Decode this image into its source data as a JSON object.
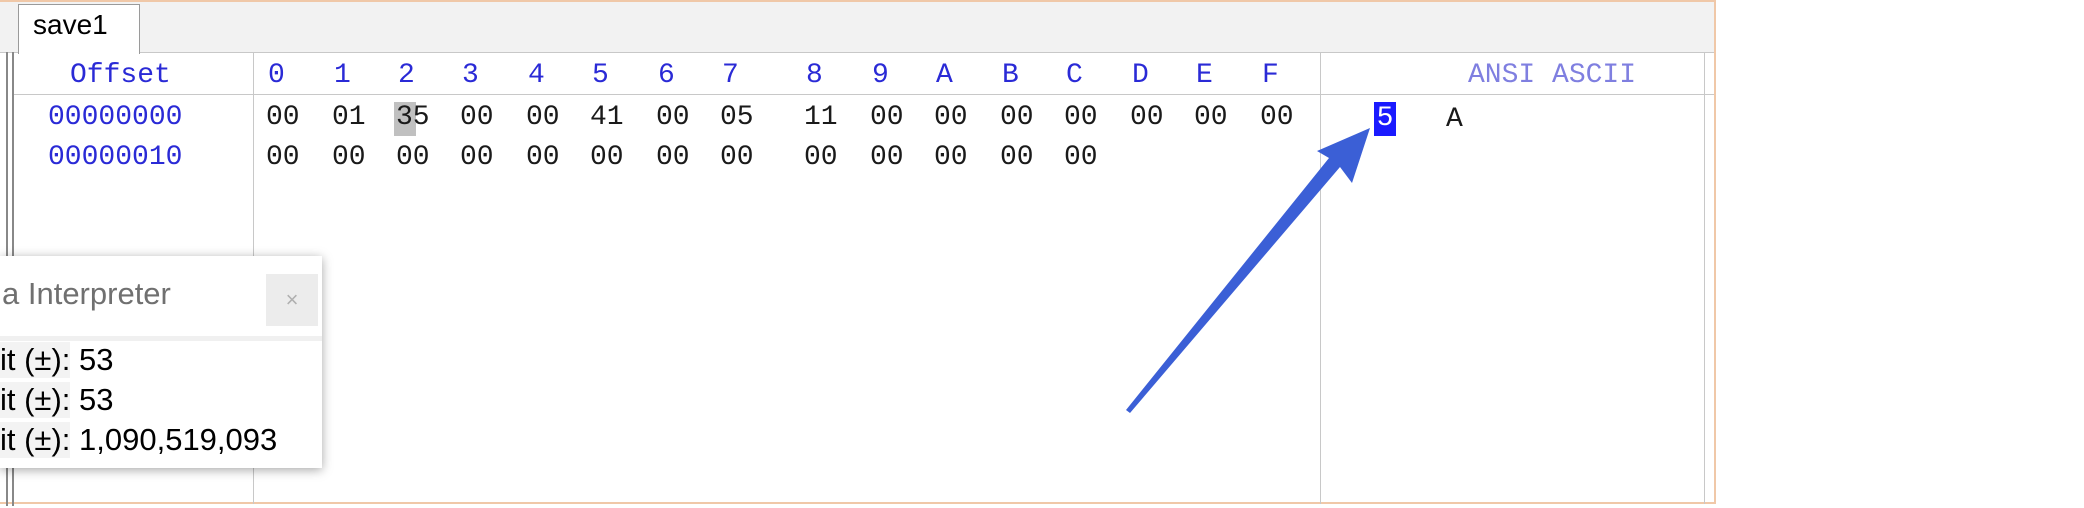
{
  "tab": {
    "label": "save1"
  },
  "header": {
    "offset_label": "Offset",
    "columns": [
      "0",
      "1",
      "2",
      "3",
      "4",
      "5",
      "6",
      "7",
      "8",
      "9",
      "A",
      "B",
      "C",
      "D",
      "E",
      "F"
    ],
    "ansi_label": "ANSI ASCII"
  },
  "rows": [
    {
      "offset": "00000000",
      "bytes": [
        "00",
        "01",
        "35",
        "00",
        "00",
        "41",
        "00",
        "05",
        "11",
        "00",
        "00",
        "00",
        "00",
        "00",
        "00",
        "00"
      ],
      "ascii": [
        "5",
        "A"
      ]
    },
    {
      "offset": "00000010",
      "bytes": [
        "00",
        "00",
        "00",
        "00",
        "00",
        "00",
        "00",
        "00",
        "00",
        "00",
        "00",
        "00",
        "00"
      ]
    }
  ],
  "selection": {
    "row": 0,
    "column": 2
  },
  "interpreter": {
    "title": "a Interpreter",
    "close_label": "×",
    "rows": [
      {
        "label": "it (±):",
        "value": "53"
      },
      {
        "label": "it (±):",
        "value": "53"
      },
      {
        "label": "it (±):",
        "value": "1,090,519,093"
      }
    ]
  },
  "colors": {
    "offset_blue": "#2a2ad6",
    "ascii_selection": "#1a1aff",
    "arrow": "#3b5fd6",
    "editor_border": "#f0c8a8"
  }
}
